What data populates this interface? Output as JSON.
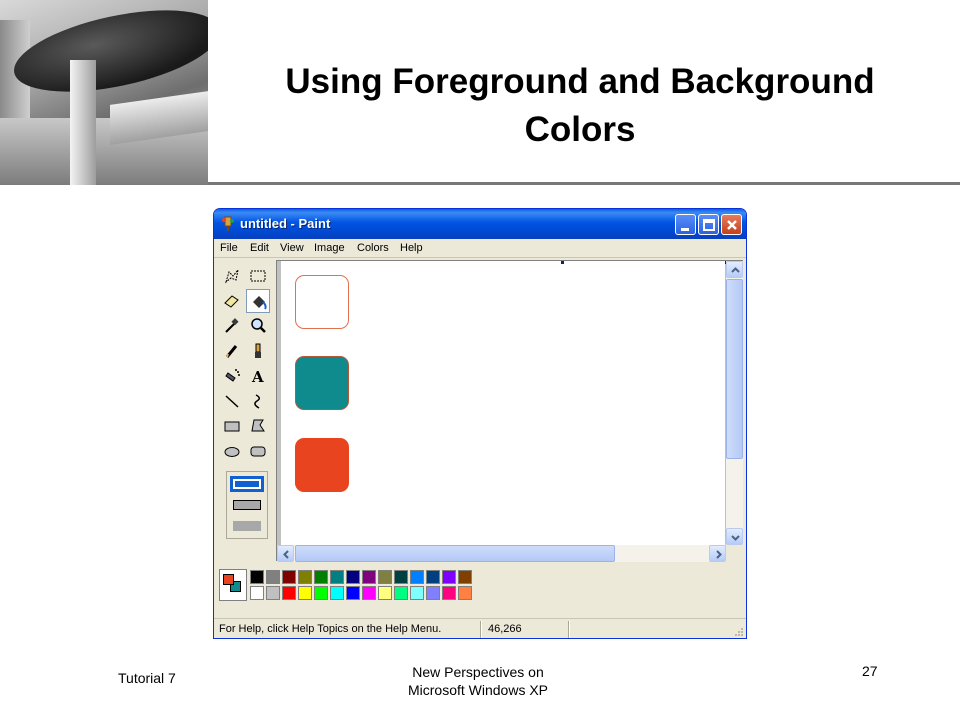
{
  "slide": {
    "title_line1": "Using Foreground and Background",
    "title_line2": "Colors",
    "footer_left": "Tutorial 7",
    "footer_center_line1": "New Perspectives on",
    "footer_center_line2": "Microsoft Windows XP",
    "page_number": "27"
  },
  "window": {
    "title": "untitled - Paint",
    "menu": [
      "File",
      "Edit",
      "View",
      "Image",
      "Colors",
      "Help"
    ],
    "status_text": "For Help, click Help Topics on the Help Menu.",
    "status_coords": "46,266"
  },
  "colors": {
    "outline_shape_border": "#e07050",
    "teal_fill": "#0f8b8d",
    "orange_fill": "#e84420",
    "foreground": "#e84420",
    "background": "#0f8b8d"
  },
  "tools": [
    "free-form-select",
    "select",
    "eraser",
    "fill-with-color",
    "pick-color",
    "magnifier",
    "pencil",
    "brush",
    "airbrush",
    "text",
    "line",
    "curve",
    "rectangle",
    "polygon",
    "ellipse",
    "rounded-rectangle"
  ],
  "palette": {
    "top": [
      "#000000",
      "#808080",
      "#800000",
      "#808000",
      "#008000",
      "#008080",
      "#000080",
      "#800080",
      "#808040",
      "#004040",
      "#0080ff",
      "#004080",
      "#8000ff",
      "#804000"
    ],
    "bottom": [
      "#ffffff",
      "#c0c0c0",
      "#ff0000",
      "#ffff00",
      "#00ff00",
      "#00ffff",
      "#0000ff",
      "#ff00ff",
      "#ffff80",
      "#00ff80",
      "#80ffff",
      "#8080ff",
      "#ff0080",
      "#ff8040"
    ]
  }
}
